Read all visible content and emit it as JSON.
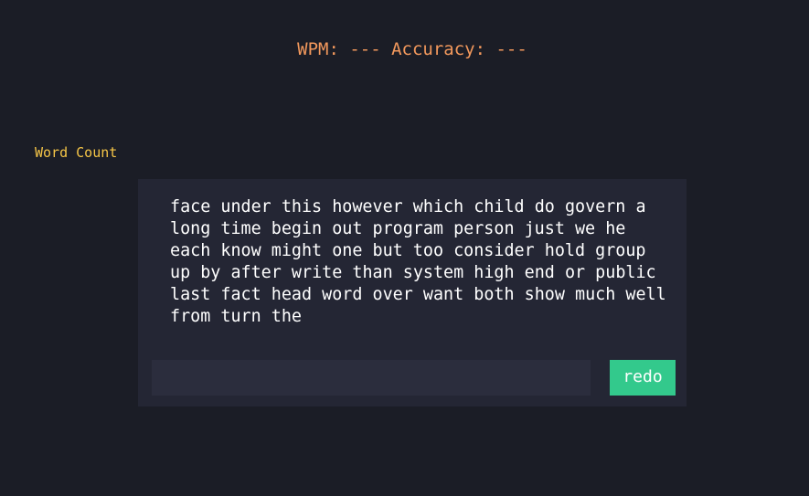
{
  "stats": {
    "text": "WPM: --- Accuracy: ---",
    "color": "#f2985c"
  },
  "word_count_label": "Word Count",
  "word_count_color": "#f5c547",
  "prompt": {
    "words": [
      "face",
      "under",
      "this",
      "however",
      "which",
      "child",
      "do",
      "govern",
      "a",
      "long",
      "time",
      "begin",
      "out",
      "program",
      "person",
      "just",
      "we",
      "he",
      "each",
      "know",
      "might",
      "one",
      "but",
      "too",
      "consider",
      "hold",
      "group",
      "up",
      "by",
      "after",
      "write",
      "than",
      "system",
      "high",
      "end",
      "or",
      "public",
      "last",
      "fact",
      "head",
      "word",
      "over",
      "want",
      "both",
      "show",
      "much",
      "well",
      "from",
      "turn",
      "the"
    ]
  },
  "input": {
    "value": "",
    "placeholder": ""
  },
  "redo_label": "redo",
  "colors": {
    "background": "#1b1d26",
    "panel": "#242634",
    "input": "#2b2d3d",
    "button": "#33c98c"
  }
}
